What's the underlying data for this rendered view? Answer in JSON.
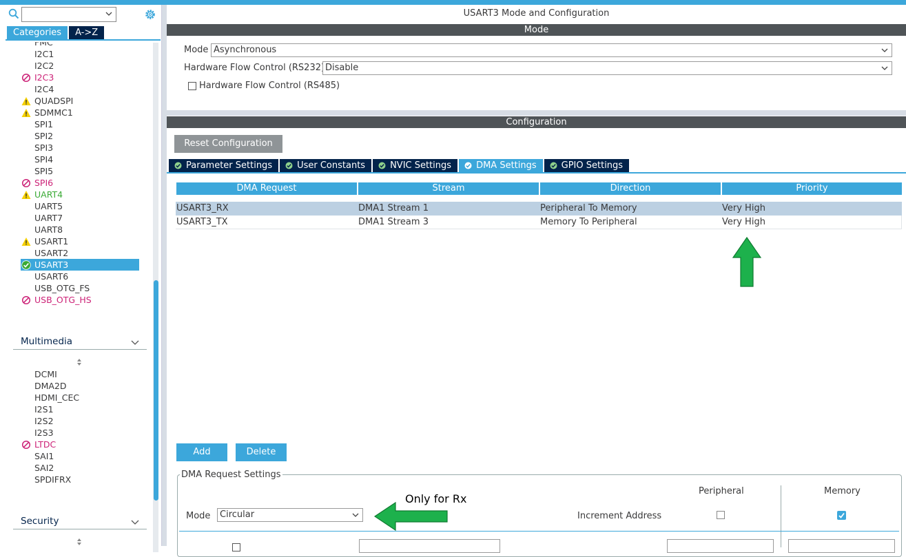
{
  "sidebar": {
    "tabs": {
      "categories": "Categories",
      "az": "A->Z"
    },
    "connectivity_items": [
      {
        "label": "FMC",
        "status": "none"
      },
      {
        "label": "I2C1",
        "status": "none"
      },
      {
        "label": "I2C2",
        "status": "none"
      },
      {
        "label": "I2C3",
        "status": "error"
      },
      {
        "label": "I2C4",
        "status": "none"
      },
      {
        "label": "QUADSPI",
        "status": "warning"
      },
      {
        "label": "SDMMC1",
        "status": "warning"
      },
      {
        "label": "SPI1",
        "status": "none"
      },
      {
        "label": "SPI2",
        "status": "none"
      },
      {
        "label": "SPI3",
        "status": "none"
      },
      {
        "label": "SPI4",
        "status": "none"
      },
      {
        "label": "SPI5",
        "status": "none"
      },
      {
        "label": "SPI6",
        "status": "error"
      },
      {
        "label": "UART4",
        "status": "warning-ok"
      },
      {
        "label": "UART5",
        "status": "none"
      },
      {
        "label": "UART7",
        "status": "none"
      },
      {
        "label": "UART8",
        "status": "none"
      },
      {
        "label": "USART1",
        "status": "warning"
      },
      {
        "label": "USART2",
        "status": "none"
      },
      {
        "label": "USART3",
        "status": "ok-selected"
      },
      {
        "label": "USART6",
        "status": "none"
      },
      {
        "label": "USB_OTG_FS",
        "status": "none"
      },
      {
        "label": "USB_OTG_HS",
        "status": "error"
      }
    ],
    "multimedia_title": "Multimedia",
    "multimedia_items": [
      {
        "label": "DCMI",
        "status": "none"
      },
      {
        "label": "DMA2D",
        "status": "none"
      },
      {
        "label": "HDMI_CEC",
        "status": "none"
      },
      {
        "label": "I2S1",
        "status": "none"
      },
      {
        "label": "I2S2",
        "status": "none"
      },
      {
        "label": "I2S3",
        "status": "none"
      },
      {
        "label": "LTDC",
        "status": "error"
      },
      {
        "label": "SAI1",
        "status": "none"
      },
      {
        "label": "SAI2",
        "status": "none"
      },
      {
        "label": "SPDIFRX",
        "status": "none"
      }
    ],
    "security_title": "Security"
  },
  "main": {
    "title": "USART3 Mode and Configuration",
    "mode_bar": "Mode",
    "mode_label": "Mode",
    "mode_value": "Asynchronous",
    "hwfc232_label": "Hardware Flow Control (RS232)",
    "hwfc232_value": "Disable",
    "hwfc485_label": "Hardware Flow Control (RS485)",
    "config_bar": "Configuration",
    "reset_button": "Reset Configuration",
    "tabs": [
      {
        "label": "Parameter Settings"
      },
      {
        "label": "User Constants"
      },
      {
        "label": "NVIC Settings"
      },
      {
        "label": "DMA Settings"
      },
      {
        "label": "GPIO Settings"
      }
    ],
    "table": {
      "headers": [
        "DMA Request",
        "Stream",
        "Direction",
        "Priority"
      ],
      "rows": [
        [
          "USART3_RX",
          "DMA1 Stream 1",
          "Peripheral To Memory",
          "Very High"
        ],
        [
          "USART3_TX",
          "DMA1 Stream 3",
          "Memory To Peripheral",
          "Very High"
        ]
      ]
    },
    "add_button": "Add",
    "delete_button": "Delete",
    "dma_settings": {
      "legend": "DMA Request Settings",
      "peripheral_header": "Peripheral",
      "memory_header": "Memory",
      "mode_label": "Mode",
      "mode_value": "Circular",
      "increment_label": "Increment Address",
      "peripheral_increment": false,
      "memory_increment": true
    },
    "annotation_text": "Only for Rx"
  },
  "colors": {
    "accent": "#3ca7db",
    "navy": "#03234b",
    "error": "#cc2277",
    "warning": "#f5d000",
    "ok": "#3aaa35",
    "arrow": "#1db14c"
  }
}
